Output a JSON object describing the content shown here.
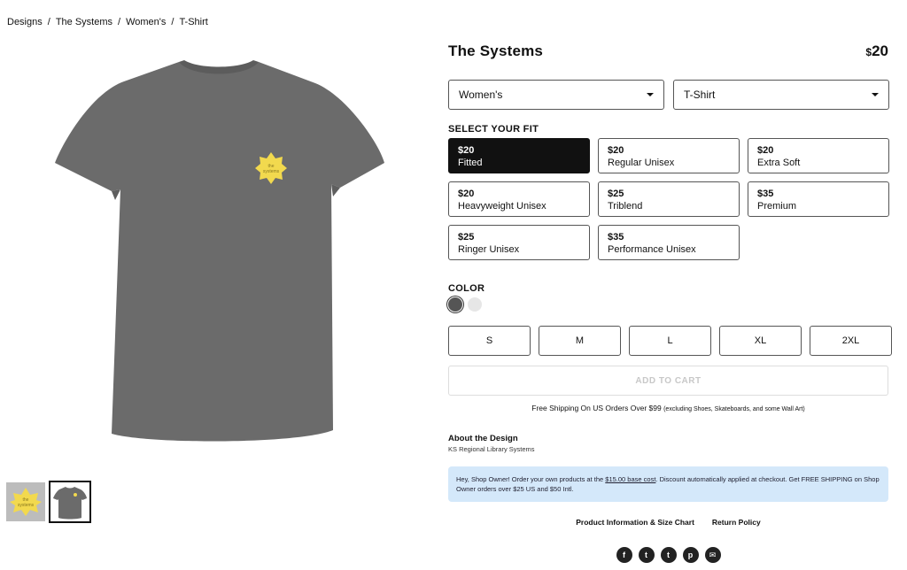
{
  "breadcrumb": [
    "Designs",
    "The Systems",
    "Women's",
    "T-Shirt"
  ],
  "breadcrumb_sep": "/",
  "product": {
    "title": "The Systems",
    "currency": "$",
    "price": "20",
    "design_badge_text": "the systems"
  },
  "selects": {
    "gender": "Women's",
    "type": "T-Shirt"
  },
  "fit_label": "SELECT YOUR FIT",
  "fits": [
    {
      "price": "$20",
      "name": "Fitted",
      "selected": true
    },
    {
      "price": "$20",
      "name": "Regular Unisex",
      "selected": false
    },
    {
      "price": "$20",
      "name": "Extra Soft",
      "selected": false
    },
    {
      "price": "$20",
      "name": "Heavyweight Unisex",
      "selected": false
    },
    {
      "price": "$25",
      "name": "Triblend",
      "selected": false
    },
    {
      "price": "$35",
      "name": "Premium",
      "selected": false
    },
    {
      "price": "$25",
      "name": "Ringer Unisex",
      "selected": false
    },
    {
      "price": "$35",
      "name": "Performance Unisex",
      "selected": false
    }
  ],
  "color_label": "COLOR",
  "colors": [
    {
      "hex": "#555555",
      "selected": true
    },
    {
      "hex": "#e6e6e6",
      "selected": false
    }
  ],
  "sizes": [
    "S",
    "M",
    "L",
    "XL",
    "2XL"
  ],
  "cart_label": "ADD TO CART",
  "shipping": {
    "main": "Free Shipping On US Orders Over $99",
    "note": "(excluding Shoes, Skateboards, and some Wall Art)"
  },
  "about": {
    "title": "About the Design",
    "author": "KS Regional Library Systems"
  },
  "notice": {
    "before": "Hey, Shop Owner! Order your own products at the ",
    "link": "$15.00 base cost",
    "after": ". Discount automatically applied at checkout. Get FREE SHIPPING on Shop Owner orders over $25 US and $50 Intl."
  },
  "links": {
    "info": "Product Information & Size Chart",
    "returns": "Return Policy"
  },
  "social": [
    {
      "icon": "facebook-icon",
      "glyph": "f"
    },
    {
      "icon": "tumblr-icon",
      "glyph": "t"
    },
    {
      "icon": "twitter-icon",
      "glyph": "t"
    },
    {
      "icon": "pinterest-icon",
      "glyph": "p"
    },
    {
      "icon": "email-icon",
      "glyph": "✉"
    }
  ],
  "colors_theme": {
    "shirt": "#6b6b6b",
    "badge": "#f2d94e",
    "selected_fit_bg": "#111111",
    "notice_bg": "#d4e8fa"
  }
}
